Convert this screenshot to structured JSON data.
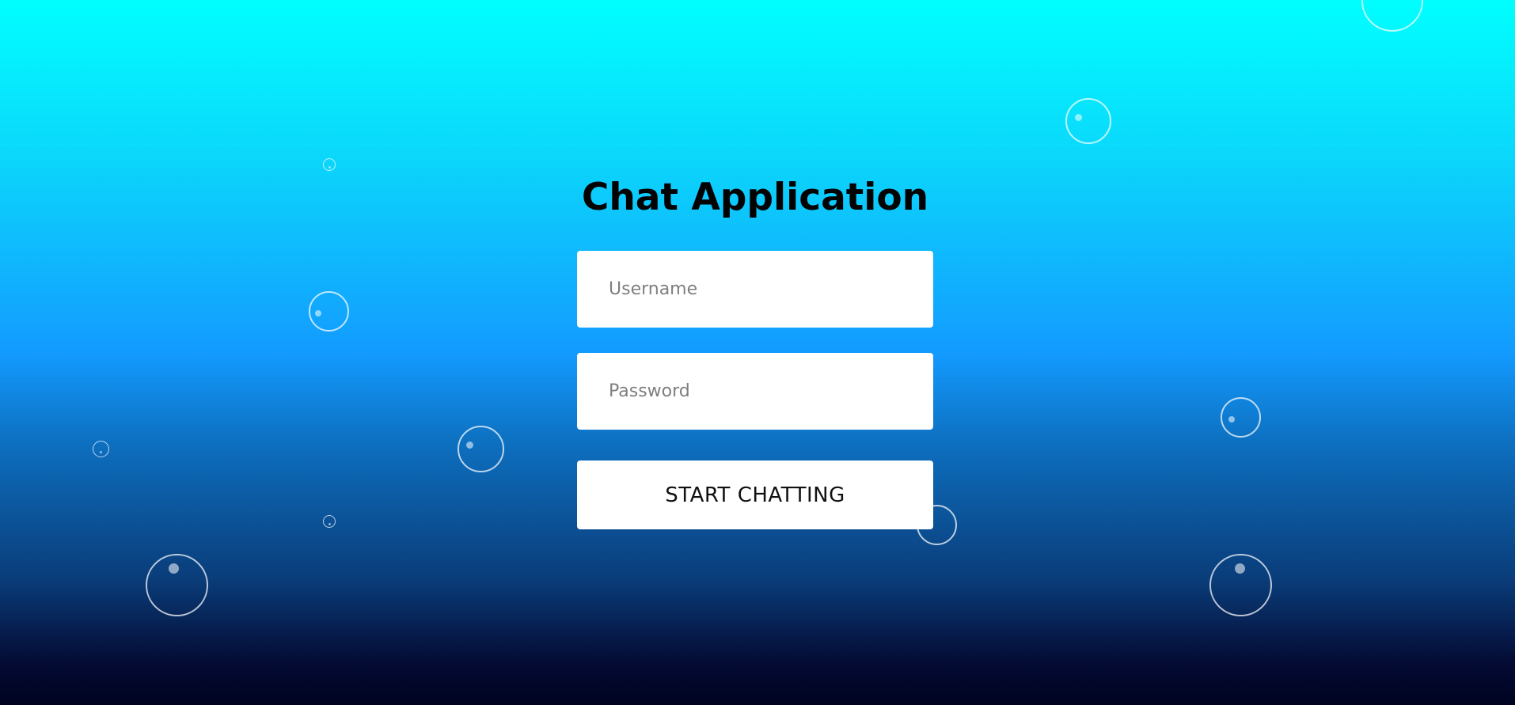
{
  "app": {
    "title": "Chat Application"
  },
  "form": {
    "username_placeholder": "Username",
    "username_value": "",
    "password_placeholder": "Password",
    "password_value": "",
    "submit_label": "START CHATTING"
  },
  "colors": {
    "gradient_top": "#00ffff",
    "gradient_mid": "#139bff",
    "gradient_bottom": "#000320",
    "card_field_bg": "#ffffff",
    "title_text": "#020202"
  },
  "icons": {
    "background_decoration": "bubble-icon"
  }
}
